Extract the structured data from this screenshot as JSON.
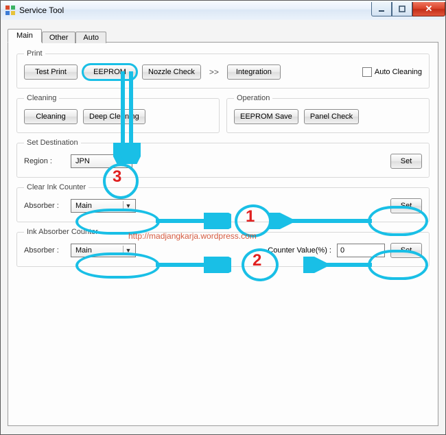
{
  "window": {
    "title": "Service Tool"
  },
  "tabs": {
    "main": "Main",
    "other": "Other",
    "auto": "Auto"
  },
  "print": {
    "legend": "Print",
    "test_print": "Test Print",
    "eeprom": "EEPROM",
    "nozzle_check": "Nozzle Check",
    "integration": "Integration",
    "auto_cleaning": "Auto Cleaning"
  },
  "cleaning": {
    "legend": "Cleaning",
    "cleaning": "Cleaning",
    "deep": "Deep Cleaning"
  },
  "operation": {
    "legend": "Operation",
    "eeprom_save": "EEPROM Save",
    "panel_check": "Panel Check"
  },
  "set_destination": {
    "legend": "Set Destination",
    "region_label": "Region :",
    "region_value": "JPN",
    "set": "Set"
  },
  "clear_ink": {
    "legend": "Clear Ink Counter",
    "absorber_label": "Absorber :",
    "absorber_value": "Main",
    "set": "Set"
  },
  "ink_absorber": {
    "legend": "Ink Absorber Counter",
    "absorber_label": "Absorber :",
    "absorber_value": "Main",
    "counter_label": "Counter Value(%) :",
    "counter_value": "0",
    "set": "Set"
  },
  "annotations": {
    "n1": "1",
    "n2": "2",
    "n3": "3",
    "watermark": "http://madjangkarja.wordpress.com"
  }
}
